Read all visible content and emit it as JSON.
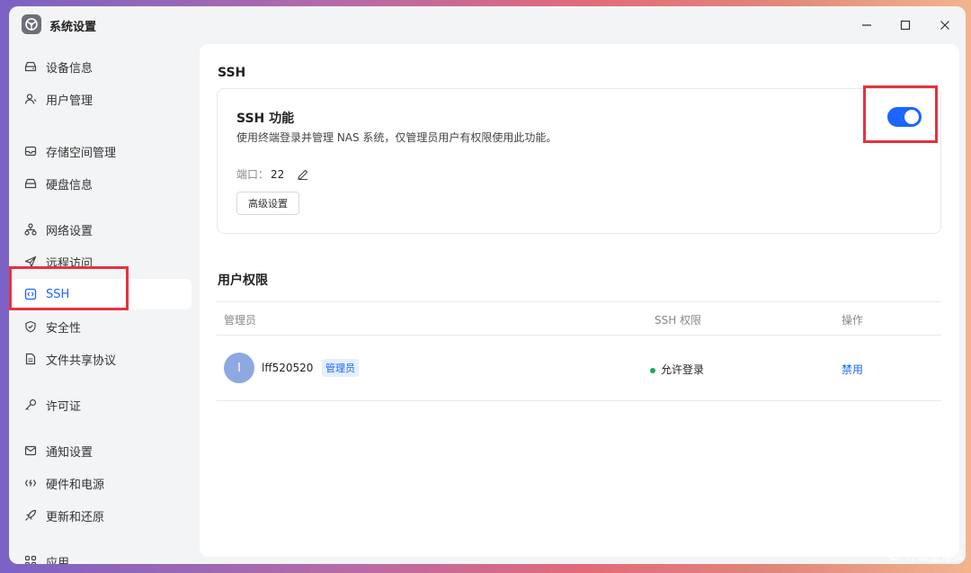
{
  "window": {
    "title": "系统设置",
    "icons": {
      "app": "steering-wheel-icon",
      "minimize": "minimize-icon",
      "maximize": "maximize-icon",
      "close": "close-icon"
    }
  },
  "sidebar": {
    "items": [
      {
        "label": "设备信息",
        "icon": "drive-icon"
      },
      {
        "label": "用户管理",
        "icon": "user-icon"
      },
      {
        "label": "存储空间管理",
        "icon": "storage-icon"
      },
      {
        "label": "硬盘信息",
        "icon": "disk-icon"
      },
      {
        "label": "网络设置",
        "icon": "network-icon"
      },
      {
        "label": "远程访问",
        "icon": "send-icon"
      },
      {
        "label": "SSH",
        "icon": "terminal-icon",
        "active": true
      },
      {
        "label": "安全性",
        "icon": "shield-icon"
      },
      {
        "label": "文件共享协议",
        "icon": "document-icon"
      },
      {
        "label": "许可证",
        "icon": "key-icon"
      },
      {
        "label": "通知设置",
        "icon": "mail-icon"
      },
      {
        "label": "硬件和电源",
        "icon": "power-icon"
      },
      {
        "label": "更新和还原",
        "icon": "rocket-icon"
      },
      {
        "label": "应用",
        "icon": "apps-icon"
      }
    ]
  },
  "main": {
    "section_title": "SSH",
    "ssh_card": {
      "title": "SSH 功能",
      "description": "使用终端登录并管理 NAS 系统，仅管理员用户有权限使用此功能。",
      "port_label": "端口：",
      "port_value": "22",
      "advanced_button": "高级设置",
      "toggle_on": true
    },
    "permissions": {
      "title": "用户权限",
      "columns": [
        "管理员",
        "SSH 权限",
        "操作"
      ],
      "rows": [
        {
          "avatar_letter": "I",
          "username": "lff520520",
          "role_badge": "管理员",
          "status": "允许登录",
          "action": "禁用"
        }
      ]
    }
  },
  "watermark": {
    "text": "什么值得买",
    "icon": "smzdm-logo-icon"
  },
  "colors": {
    "accent": "#1a66ff",
    "status_green": "#17a95b",
    "highlight_red": "#e4333c"
  }
}
